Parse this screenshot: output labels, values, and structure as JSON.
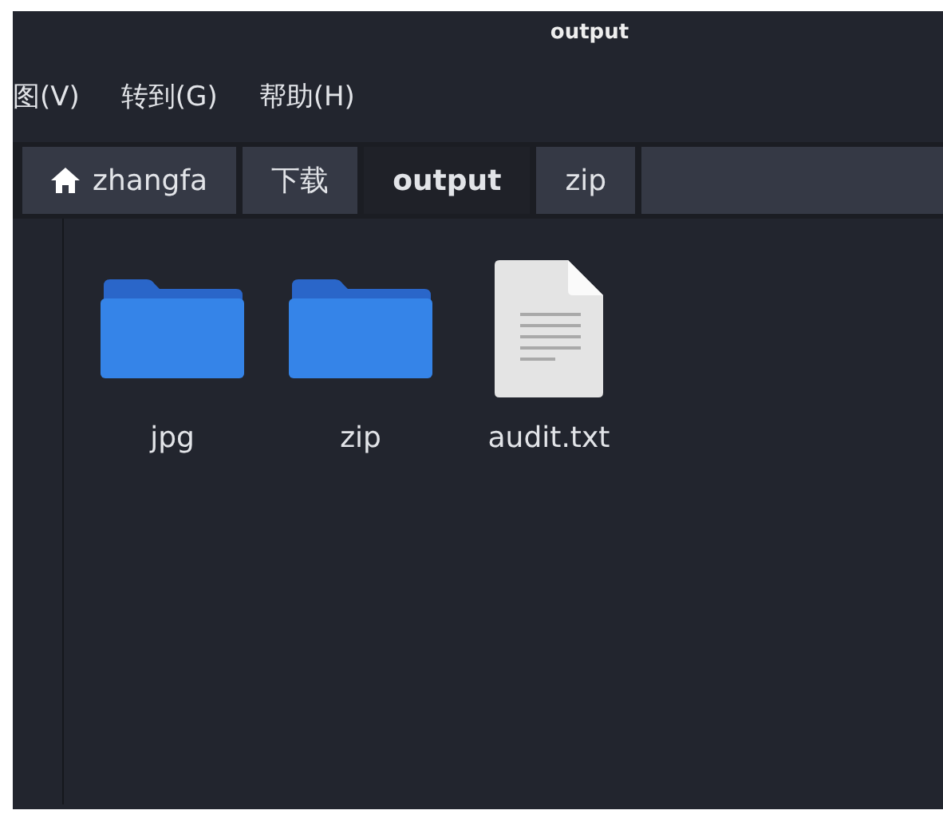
{
  "window": {
    "title": "output"
  },
  "menu": [
    "图(V)",
    "转到(G)",
    "帮助(H)"
  ],
  "path_bar": [
    {
      "label": "zhangfa",
      "kind": "home",
      "selected": false
    },
    {
      "label": "下载",
      "kind": "plain",
      "selected": false
    },
    {
      "label": "output",
      "kind": "plain",
      "selected": true
    },
    {
      "label": "zip",
      "kind": "plain",
      "selected": false
    }
  ],
  "files": [
    {
      "name": "jpg",
      "kind": "folder"
    },
    {
      "name": "zip",
      "kind": "folder"
    },
    {
      "name": "audit.txt",
      "kind": "text"
    }
  ]
}
